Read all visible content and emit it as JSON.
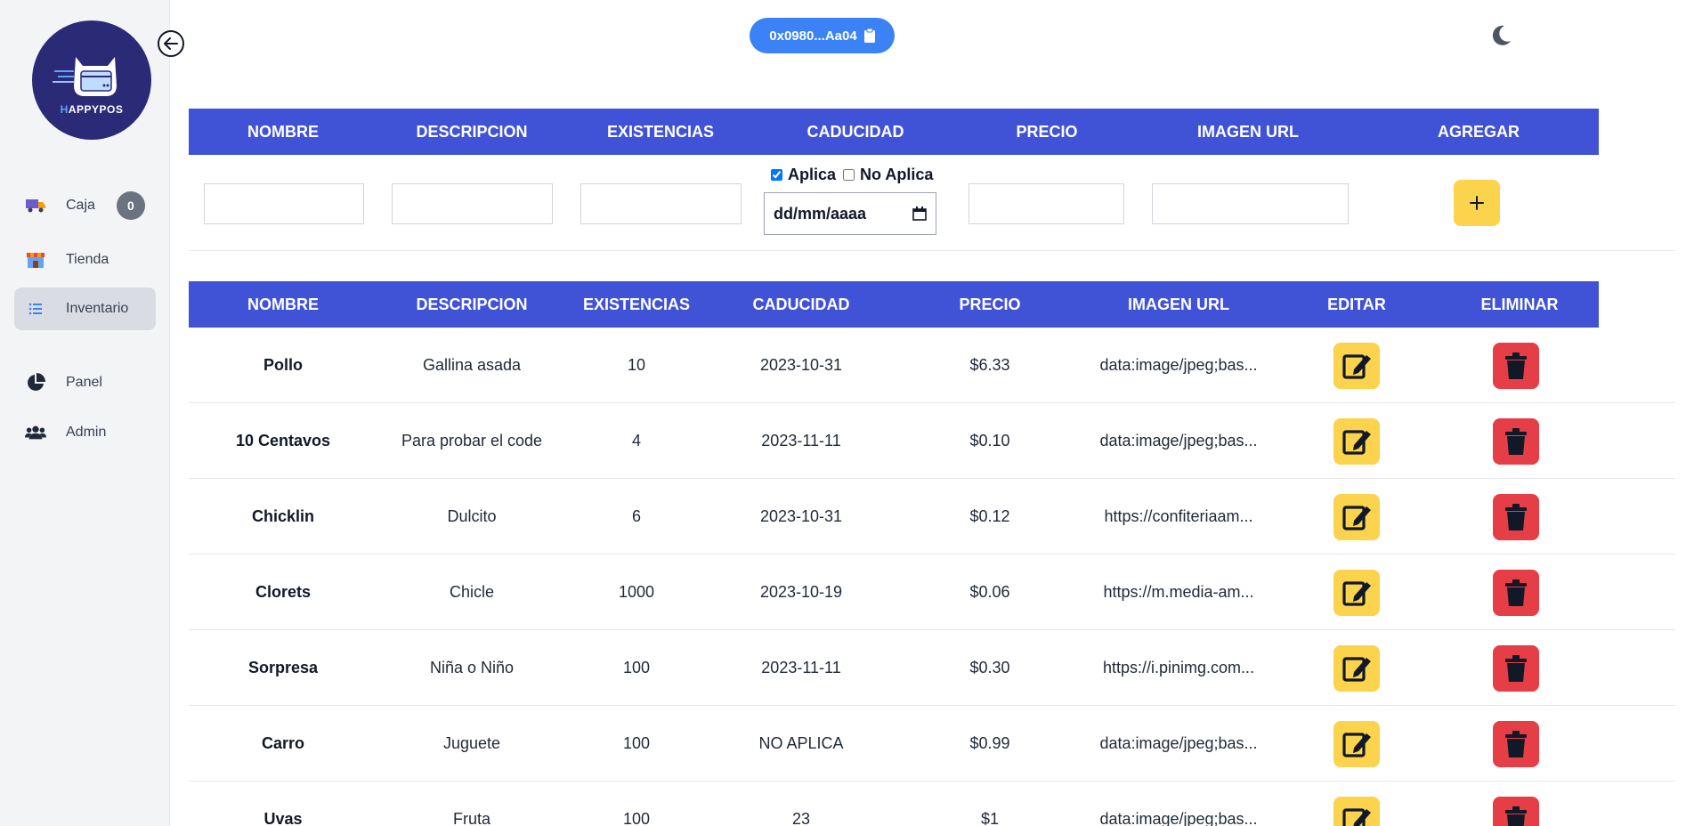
{
  "app": {
    "logo_text_prefix": "H",
    "logo_text_rest": "APPYPOS",
    "wallet_address": "0x0980...Aa04"
  },
  "sidebar": {
    "items": [
      {
        "label": "Caja",
        "icon": "truck-icon",
        "badge": "0"
      },
      {
        "label": "Tienda",
        "icon": "store-icon"
      },
      {
        "label": "Inventario",
        "icon": "list-icon",
        "active": true
      },
      {
        "label": "Panel",
        "icon": "pie-chart-icon"
      },
      {
        "label": "Admin",
        "icon": "users-icon"
      }
    ]
  },
  "form": {
    "headers": [
      "NOMBRE",
      "DESCRIPCION",
      "EXISTENCIAS",
      "CADUCIDAD",
      "PRECIO",
      "IMAGEN URL",
      "AGREGAR"
    ],
    "caducidad_opt1": "Aplica",
    "caducidad_opt2": "No Aplica",
    "aplica_checked": true,
    "no_aplica_checked": false,
    "date_placeholder": "dd/mm/aaaa",
    "nombre_value": "",
    "descripcion_value": "",
    "existencias_value": "",
    "precio_value": "",
    "imagen_value": ""
  },
  "table": {
    "headers": [
      "NOMBRE",
      "DESCRIPCION",
      "EXISTENCIAS",
      "CADUCIDAD",
      "PRECIO",
      "IMAGEN URL",
      "EDITAR",
      "ELIMINAR"
    ],
    "rows": [
      {
        "nombre": "Pollo",
        "descripcion": "Gallina asada",
        "existencias": "10",
        "caducidad": "2023-10-31",
        "precio": "$6.33",
        "imagen": "data:image/jpeg;bas..."
      },
      {
        "nombre": "10 Centavos",
        "descripcion": "Para probar el code",
        "existencias": "4",
        "caducidad": "2023-11-11",
        "precio": "$0.10",
        "imagen": "data:image/jpeg;bas..."
      },
      {
        "nombre": "Chicklin",
        "descripcion": "Dulcito",
        "existencias": "6",
        "caducidad": "2023-10-31",
        "precio": "$0.12",
        "imagen": "https://confiteriaam..."
      },
      {
        "nombre": "Clorets",
        "descripcion": "Chicle",
        "existencias": "1000",
        "caducidad": "2023-10-19",
        "precio": "$0.06",
        "imagen": "https://m.media-am..."
      },
      {
        "nombre": "Sorpresa",
        "descripcion": "Niña o Niño",
        "existencias": "100",
        "caducidad": "2023-11-11",
        "precio": "$0.30",
        "imagen": "https://i.pinimg.com..."
      },
      {
        "nombre": "Carro",
        "descripcion": "Juguete",
        "existencias": "100",
        "caducidad": "NO APLICA",
        "precio": "$0.99",
        "imagen": "data:image/jpeg;bas..."
      },
      {
        "nombre": "Uvas",
        "descripcion": "Fruta",
        "existencias": "100",
        "caducidad": "23",
        "precio": "$1",
        "imagen": "data:image/jpeg;bas..."
      }
    ]
  },
  "colors": {
    "header_bg": "#4052d6",
    "edit_bg": "#fcd34d",
    "delete_bg": "#e53e46",
    "wallet_bg": "#3b82f6",
    "logo_bg": "#2b2a77"
  }
}
